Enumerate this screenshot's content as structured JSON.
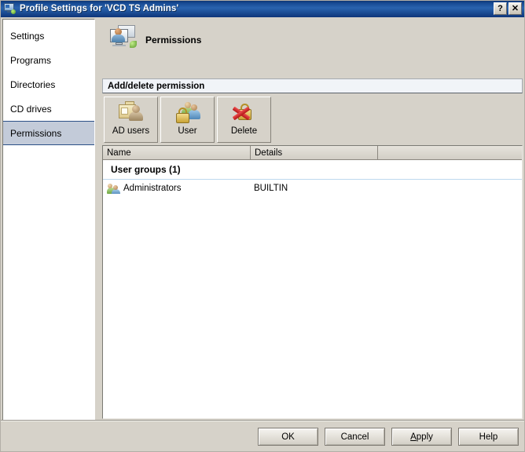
{
  "window": {
    "title": "Profile Settings for 'VCD TS Admins'",
    "icon": "computer-user-icon",
    "help_button": "?",
    "close_button": "✕"
  },
  "sidebar": {
    "items": [
      {
        "label": "Settings",
        "selected": false
      },
      {
        "label": "Programs",
        "selected": false
      },
      {
        "label": "Directories",
        "selected": false
      },
      {
        "label": "CD drives",
        "selected": false
      },
      {
        "label": "Permissions",
        "selected": true
      }
    ]
  },
  "header": {
    "icon": "permissions-monitor-user-icon",
    "title": "Permissions"
  },
  "section": {
    "title": "Add/delete permission"
  },
  "toolbar": {
    "buttons": [
      {
        "label": "AD users",
        "icon": "folder-user-icon"
      },
      {
        "label": "User",
        "icon": "lock-users-icon"
      },
      {
        "label": "Delete",
        "icon": "lock-delete-icon"
      }
    ]
  },
  "list": {
    "columns": [
      "Name",
      "Details",
      ""
    ],
    "groups": [
      {
        "title": "User groups (1)",
        "rows": [
          {
            "icon": "user-group-icon",
            "name": "Administrators",
            "details": "BUILTIN",
            "extra": ""
          }
        ]
      }
    ]
  },
  "footer": {
    "buttons": [
      {
        "label": "OK",
        "accel": ""
      },
      {
        "label": "Cancel",
        "accel": ""
      },
      {
        "label": "Apply",
        "accel": "A"
      },
      {
        "label": "Help",
        "accel": ""
      }
    ]
  },
  "colors": {
    "title_bar_start": "#0a2f6b",
    "title_bar_end": "#2a63ae",
    "dialog_face": "#d6d2c9",
    "selection_fill": "#c3cbd9",
    "selection_border": "#2b4f87",
    "section_bar": "#f1f4f8",
    "group_rule": "#bcd9ee"
  }
}
